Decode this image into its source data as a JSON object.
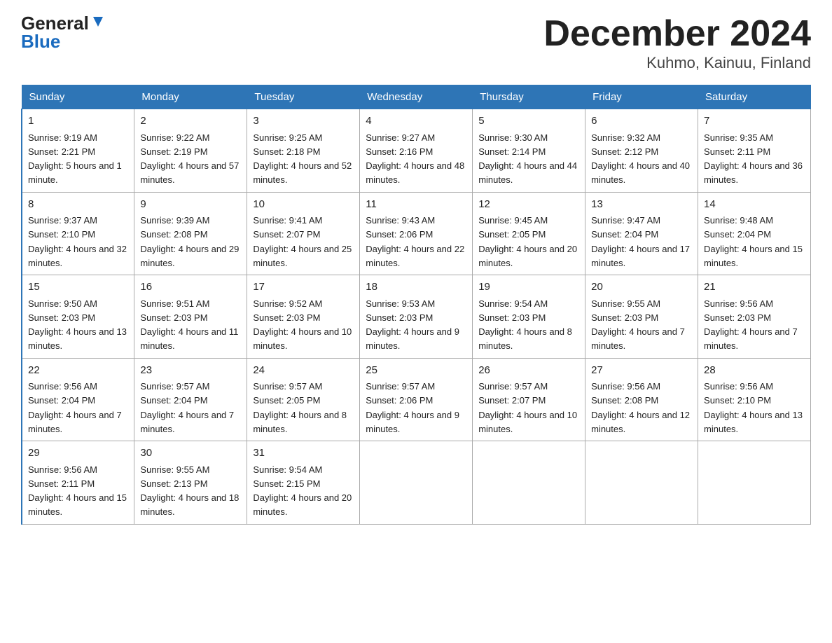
{
  "header": {
    "logo_general": "General",
    "logo_blue": "Blue",
    "title": "December 2024",
    "subtitle": "Kuhmo, Kainuu, Finland"
  },
  "days_of_week": [
    "Sunday",
    "Monday",
    "Tuesday",
    "Wednesday",
    "Thursday",
    "Friday",
    "Saturday"
  ],
  "weeks": [
    [
      {
        "day": "1",
        "sunrise": "9:19 AM",
        "sunset": "2:21 PM",
        "daylight": "5 hours and 1 minute."
      },
      {
        "day": "2",
        "sunrise": "9:22 AM",
        "sunset": "2:19 PM",
        "daylight": "4 hours and 57 minutes."
      },
      {
        "day": "3",
        "sunrise": "9:25 AM",
        "sunset": "2:18 PM",
        "daylight": "4 hours and 52 minutes."
      },
      {
        "day": "4",
        "sunrise": "9:27 AM",
        "sunset": "2:16 PM",
        "daylight": "4 hours and 48 minutes."
      },
      {
        "day": "5",
        "sunrise": "9:30 AM",
        "sunset": "2:14 PM",
        "daylight": "4 hours and 44 minutes."
      },
      {
        "day": "6",
        "sunrise": "9:32 AM",
        "sunset": "2:12 PM",
        "daylight": "4 hours and 40 minutes."
      },
      {
        "day": "7",
        "sunrise": "9:35 AM",
        "sunset": "2:11 PM",
        "daylight": "4 hours and 36 minutes."
      }
    ],
    [
      {
        "day": "8",
        "sunrise": "9:37 AM",
        "sunset": "2:10 PM",
        "daylight": "4 hours and 32 minutes."
      },
      {
        "day": "9",
        "sunrise": "9:39 AM",
        "sunset": "2:08 PM",
        "daylight": "4 hours and 29 minutes."
      },
      {
        "day": "10",
        "sunrise": "9:41 AM",
        "sunset": "2:07 PM",
        "daylight": "4 hours and 25 minutes."
      },
      {
        "day": "11",
        "sunrise": "9:43 AM",
        "sunset": "2:06 PM",
        "daylight": "4 hours and 22 minutes."
      },
      {
        "day": "12",
        "sunrise": "9:45 AM",
        "sunset": "2:05 PM",
        "daylight": "4 hours and 20 minutes."
      },
      {
        "day": "13",
        "sunrise": "9:47 AM",
        "sunset": "2:04 PM",
        "daylight": "4 hours and 17 minutes."
      },
      {
        "day": "14",
        "sunrise": "9:48 AM",
        "sunset": "2:04 PM",
        "daylight": "4 hours and 15 minutes."
      }
    ],
    [
      {
        "day": "15",
        "sunrise": "9:50 AM",
        "sunset": "2:03 PM",
        "daylight": "4 hours and 13 minutes."
      },
      {
        "day": "16",
        "sunrise": "9:51 AM",
        "sunset": "2:03 PM",
        "daylight": "4 hours and 11 minutes."
      },
      {
        "day": "17",
        "sunrise": "9:52 AM",
        "sunset": "2:03 PM",
        "daylight": "4 hours and 10 minutes."
      },
      {
        "day": "18",
        "sunrise": "9:53 AM",
        "sunset": "2:03 PM",
        "daylight": "4 hours and 9 minutes."
      },
      {
        "day": "19",
        "sunrise": "9:54 AM",
        "sunset": "2:03 PM",
        "daylight": "4 hours and 8 minutes."
      },
      {
        "day": "20",
        "sunrise": "9:55 AM",
        "sunset": "2:03 PM",
        "daylight": "4 hours and 7 minutes."
      },
      {
        "day": "21",
        "sunrise": "9:56 AM",
        "sunset": "2:03 PM",
        "daylight": "4 hours and 7 minutes."
      }
    ],
    [
      {
        "day": "22",
        "sunrise": "9:56 AM",
        "sunset": "2:04 PM",
        "daylight": "4 hours and 7 minutes."
      },
      {
        "day": "23",
        "sunrise": "9:57 AM",
        "sunset": "2:04 PM",
        "daylight": "4 hours and 7 minutes."
      },
      {
        "day": "24",
        "sunrise": "9:57 AM",
        "sunset": "2:05 PM",
        "daylight": "4 hours and 8 minutes."
      },
      {
        "day": "25",
        "sunrise": "9:57 AM",
        "sunset": "2:06 PM",
        "daylight": "4 hours and 9 minutes."
      },
      {
        "day": "26",
        "sunrise": "9:57 AM",
        "sunset": "2:07 PM",
        "daylight": "4 hours and 10 minutes."
      },
      {
        "day": "27",
        "sunrise": "9:56 AM",
        "sunset": "2:08 PM",
        "daylight": "4 hours and 12 minutes."
      },
      {
        "day": "28",
        "sunrise": "9:56 AM",
        "sunset": "2:10 PM",
        "daylight": "4 hours and 13 minutes."
      }
    ],
    [
      {
        "day": "29",
        "sunrise": "9:56 AM",
        "sunset": "2:11 PM",
        "daylight": "4 hours and 15 minutes."
      },
      {
        "day": "30",
        "sunrise": "9:55 AM",
        "sunset": "2:13 PM",
        "daylight": "4 hours and 18 minutes."
      },
      {
        "day": "31",
        "sunrise": "9:54 AM",
        "sunset": "2:15 PM",
        "daylight": "4 hours and 20 minutes."
      },
      null,
      null,
      null,
      null
    ]
  ]
}
